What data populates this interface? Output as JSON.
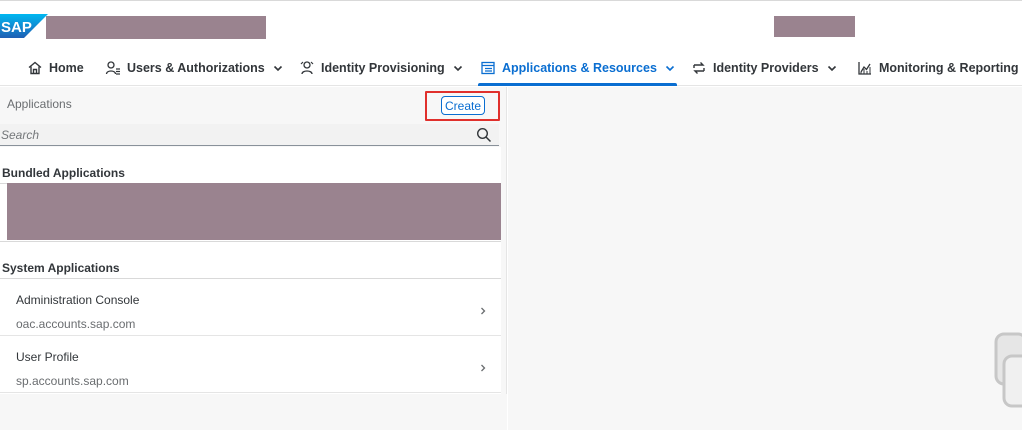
{
  "shell": {
    "logo_text": "SAP"
  },
  "nav": {
    "items": [
      {
        "label": "Home",
        "icon": "home-icon"
      },
      {
        "label": "Users & Authorizations",
        "icon": "users-icon"
      },
      {
        "label": "Identity Provisioning",
        "icon": "provisioning-icon"
      },
      {
        "label": "Applications & Resources",
        "icon": "applications-icon",
        "active": true
      },
      {
        "label": "Identity Providers",
        "icon": "identity-providers-icon"
      },
      {
        "label": "Monitoring & Reporting",
        "icon": "monitoring-icon"
      }
    ]
  },
  "left": {
    "title": "Applications",
    "create_label": "Create",
    "search_placeholder": "Search",
    "groups": {
      "bundled": "Bundled Applications",
      "system": "System Applications"
    },
    "system_apps": [
      {
        "name": "Administration Console",
        "host": "oac.accounts.sap.com"
      },
      {
        "name": "User Profile",
        "host": "sp.accounts.sap.com"
      }
    ]
  },
  "colors": {
    "accent": "#0a6ed1",
    "highlight": "#e0302c",
    "redaction": "#9a838f"
  }
}
